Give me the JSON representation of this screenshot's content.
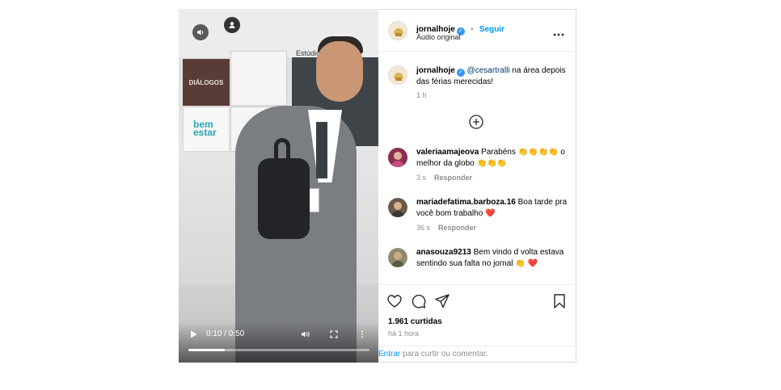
{
  "post": {
    "account": {
      "username": "jornalhoje",
      "verified_mark": "✓",
      "follow_label": "Seguir",
      "separator": "•",
      "audio_label": "Áudio original",
      "more_icon": "more-horizontal-icon"
    },
    "caption": {
      "username": "jornalhoje",
      "mention": "@cesartralli",
      "text": " na área depois das férias merecidas!",
      "time": "1 h"
    },
    "load_more_icon": "plus-circle-icon",
    "comments": [
      {
        "username": "valeriaamajeova",
        "text": " Parabéns 👏👏👏👏 o melhor da globo 👏👏👏",
        "time": "3 s",
        "reply_label": "Responder"
      },
      {
        "username": "mariadefatima.barboza.16",
        "text": " Boa tarde pra você bom trabalho ❤️",
        "time": "36 s",
        "reply_label": "Responder"
      },
      {
        "username": "anasouza9213",
        "text": " Bem vindo d volta estava sentindo sua falta no jornal 👏 ❤️",
        "time": "",
        "reply_label": ""
      }
    ],
    "likes": "1.961 curtidas",
    "posted_time": "há 1 hora",
    "login_prompt": {
      "link": "Entrar",
      "text": " para curtir ou comentar."
    }
  },
  "video": {
    "panel_label_1": "DIÁLOGOS",
    "panel_label_2": "bem estar",
    "studio_label": "Estúdio",
    "time_display": "0:10 / 0:50",
    "progress": 0.2
  },
  "colors": {
    "link_blue": "#0095f6",
    "verified_blue": "#3897f0",
    "heart_red": "#d6223d"
  }
}
